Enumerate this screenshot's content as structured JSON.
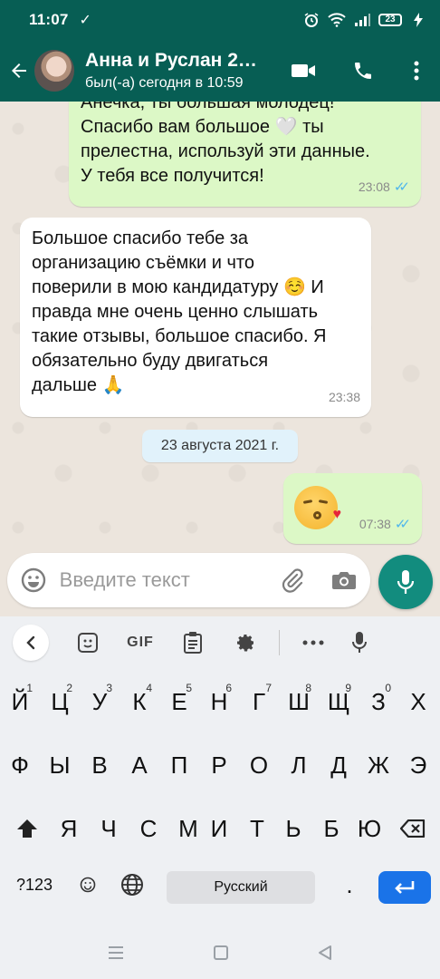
{
  "status_bar": {
    "time": "11:07",
    "battery": "23"
  },
  "header": {
    "contact_name": "Анна и Руслан 2…",
    "last_seen": "был(-а) сегодня в 10:59"
  },
  "chat": {
    "messages": [
      {
        "text": "Анечка, ты большая молодец!\nСпасибо вам большое 🤍 ты\nпрелестна, используй эти данные.\nУ тебя все получится!",
        "time": "23:08"
      },
      {
        "text": "Большое спасибо тебе за\nорганизацию съёмки и что\nповерили в мою кандидатуру ☺️ И\nправда мне очень ценно слышать\nтакие отзывы, большое спасибо. Я\nобязательно буду двигаться\nдальше 🙏",
        "time": "23:38"
      },
      {
        "time": "07:38"
      }
    ],
    "date_chip": "23 августа 2021 г."
  },
  "composer": {
    "placeholder": "Введите текст"
  },
  "keyboard": {
    "toolbar": {
      "gif": "GIF"
    },
    "row1": [
      {
        "k": "Й",
        "h": "1"
      },
      {
        "k": "Ц",
        "h": "2"
      },
      {
        "k": "У",
        "h": "3"
      },
      {
        "k": "К",
        "h": "4"
      },
      {
        "k": "Е",
        "h": "5"
      },
      {
        "k": "Н",
        "h": "6"
      },
      {
        "k": "Г",
        "h": "7"
      },
      {
        "k": "Ш",
        "h": "8"
      },
      {
        "k": "Щ",
        "h": "9"
      },
      {
        "k": "З",
        "h": "0"
      },
      {
        "k": "Х",
        "h": ""
      }
    ],
    "row2": [
      "Ф",
      "Ы",
      "В",
      "А",
      "П",
      "Р",
      "О",
      "Л",
      "Д",
      "Ж",
      "Э"
    ],
    "row3": [
      "Я",
      "Ч",
      "С",
      "М",
      "И",
      "Т",
      "Ь",
      "Б",
      "Ю"
    ],
    "symbols_label": "?123",
    "space_label": "Русский",
    "period_label": "."
  },
  "colors": {
    "header": "#075e54",
    "outgoing_bubble": "#dcf8c6",
    "incoming_bubble": "#ffffff",
    "accent": "#128c7e",
    "read_ticks": "#4fb6ec",
    "enter_key": "#1a73e8"
  }
}
